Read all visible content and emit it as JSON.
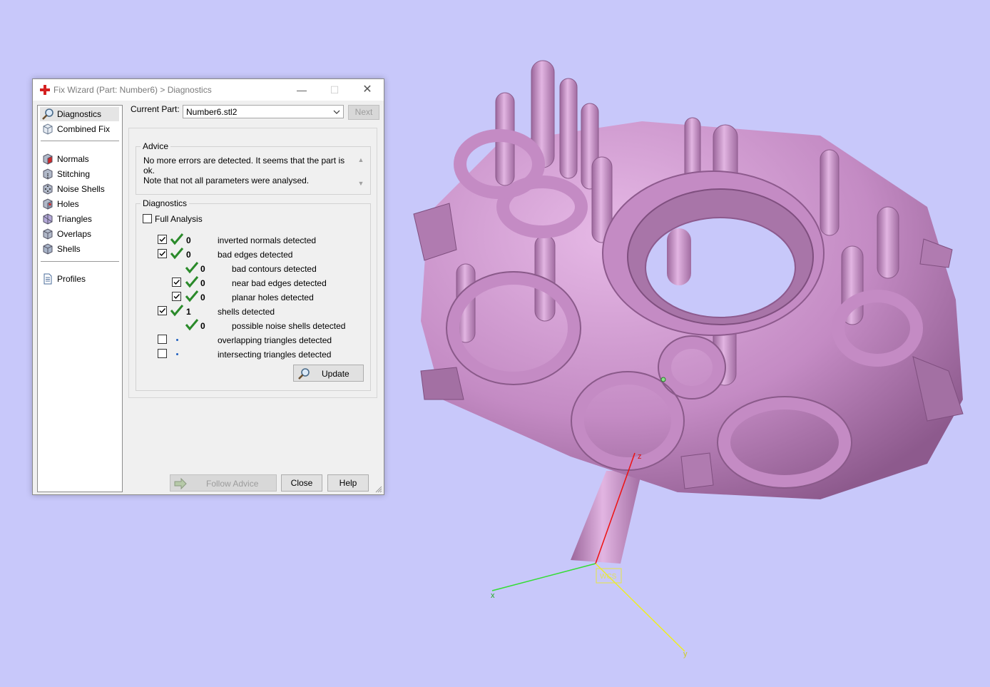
{
  "dialog": {
    "title": "Fix Wizard (Part: Number6) > Diagnostics",
    "window_controls": {
      "minimize": "—",
      "maximize": "☐",
      "close": "✕"
    }
  },
  "nav": {
    "items": [
      {
        "label": "Diagnostics",
        "icon": "magnifier-icon",
        "selected": true
      },
      {
        "label": "Combined Fix",
        "icon": "cube-outline-icon"
      },
      {
        "label": "Normals",
        "icon": "cube-red-face-icon"
      },
      {
        "label": "Stitching",
        "icon": "cube-stitching-icon"
      },
      {
        "label": "Noise Shells",
        "icon": "cube-dots-icon"
      },
      {
        "label": "Holes",
        "icon": "cube-hole-icon"
      },
      {
        "label": "Triangles",
        "icon": "cube-triangles-icon"
      },
      {
        "label": "Overlaps",
        "icon": "cube-overlaps-icon"
      },
      {
        "label": "Shells",
        "icon": "cube-shells-icon"
      },
      {
        "label": "Profiles",
        "icon": "document-icon"
      }
    ]
  },
  "current_part": {
    "label": "Current Part:",
    "value": "Number6.stl2"
  },
  "buttons": {
    "next": "Next",
    "update": "Update",
    "follow_advice": "Follow Advice",
    "close": "Close",
    "help": "Help"
  },
  "advice": {
    "title": "Advice",
    "line1": "No more errors are detected. It seems that the part is ok.",
    "line2": "Note that not all parameters were analysed."
  },
  "diagnostics": {
    "title": "Diagnostics",
    "full_analysis_label": "Full Analysis",
    "full_analysis_checked": false,
    "rows": [
      {
        "checkbox": true,
        "checked": true,
        "status": "ok",
        "count": "0",
        "label": "inverted normals detected",
        "indent": 0
      },
      {
        "checkbox": true,
        "checked": true,
        "status": "ok",
        "count": "0",
        "label": "bad edges detected",
        "indent": 0
      },
      {
        "checkbox": false,
        "checked": false,
        "status": "ok",
        "count": "0",
        "label": "bad contours detected",
        "indent": 1
      },
      {
        "checkbox": true,
        "checked": true,
        "status": "ok",
        "count": "0",
        "label": "near bad edges detected",
        "indent": 1
      },
      {
        "checkbox": true,
        "checked": true,
        "status": "ok",
        "count": "0",
        "label": "planar holes detected",
        "indent": 1
      },
      {
        "checkbox": true,
        "checked": true,
        "status": "ok",
        "count": "1",
        "label": "shells detected",
        "indent": 0
      },
      {
        "checkbox": false,
        "checked": false,
        "status": "ok",
        "count": "0",
        "label": "possible noise shells detected",
        "indent": 1
      },
      {
        "checkbox": true,
        "checked": false,
        "status": "pending",
        "count": "",
        "label": "overlapping triangles detected",
        "indent": 0
      },
      {
        "checkbox": true,
        "checked": false,
        "status": "pending",
        "count": "",
        "label": "intersecting triangles detected",
        "indent": 0
      }
    ]
  },
  "viewport": {
    "background": "#c8c8fa",
    "model_color": "#c98fc9",
    "axes": {
      "x": "x",
      "y": "y",
      "z": "z",
      "origin_label": "WCS"
    }
  }
}
